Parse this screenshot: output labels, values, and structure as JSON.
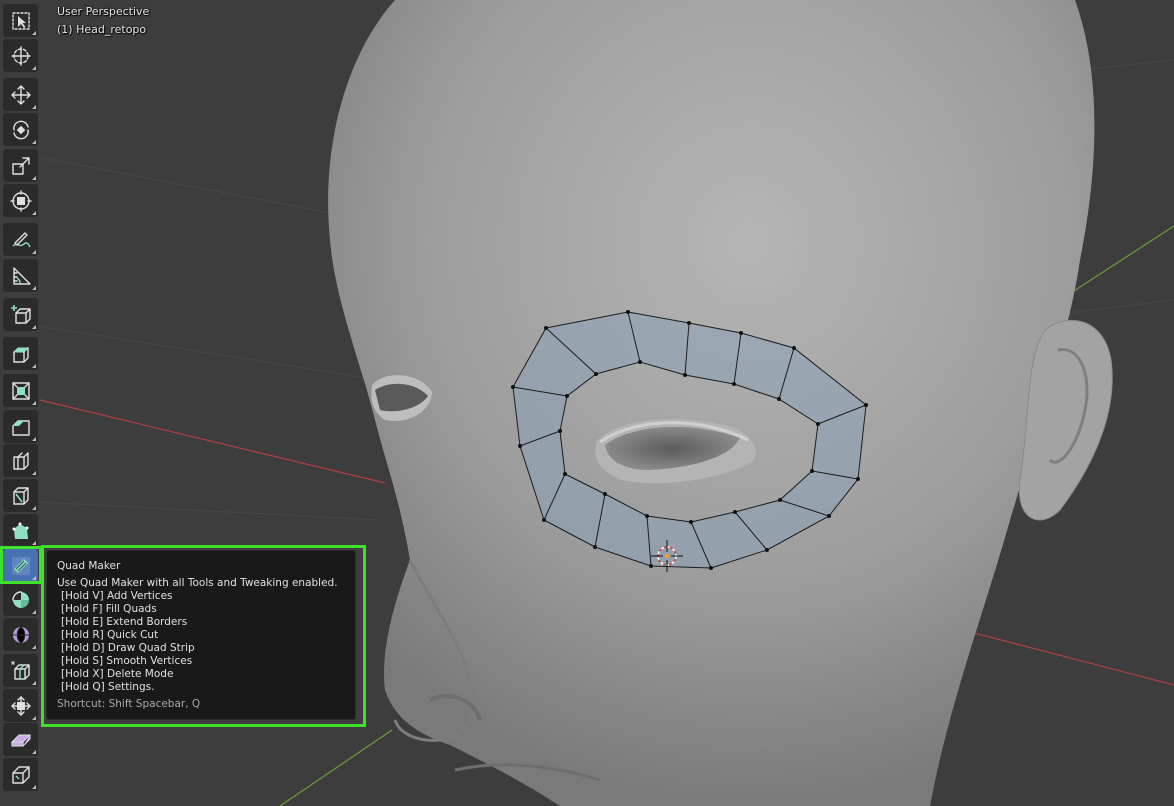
{
  "viewport": {
    "view_name": "User Perspective",
    "object_label": "(1) Head_retopo"
  },
  "toolbar": {
    "tools": [
      {
        "icon": "select-box-icon"
      },
      {
        "icon": "cursor-icon"
      },
      {
        "icon": "move-icon"
      },
      {
        "icon": "rotate-icon"
      },
      {
        "icon": "scale-icon"
      },
      {
        "icon": "transform-icon"
      },
      {
        "icon": "annotate-icon"
      },
      {
        "icon": "measure-icon"
      },
      {
        "icon": "add-cube-icon"
      },
      {
        "icon": "extrude-region-icon"
      },
      {
        "icon": "inset-faces-icon"
      },
      {
        "icon": "bevel-icon"
      },
      {
        "icon": "loop-cut-icon"
      },
      {
        "icon": "knife-icon"
      },
      {
        "icon": "poly-build-icon"
      },
      {
        "icon": "quad-maker-icon",
        "active": true
      },
      {
        "icon": "spin-icon"
      },
      {
        "icon": "smooth-icon"
      },
      {
        "icon": "edge-slide-icon"
      },
      {
        "icon": "shrink-fatten-icon"
      },
      {
        "icon": "shear-icon"
      },
      {
        "icon": "rip-region-icon"
      }
    ]
  },
  "tooltip": {
    "title": "Quad Maker",
    "description": "Use Quad Maker with all Tools and Tweaking enabled.",
    "keys": [
      "[Hold V] Add Vertices",
      "[Hold F] Fill Quads",
      "[Hold E] Extend Borders",
      "[Hold R] Quick Cut",
      "[Hold D] Draw Quad Strip",
      "[Hold S] Smooth Vertices",
      "[Hold X] Delete Mode",
      "[Hold Q] Settings."
    ],
    "shortcut": "Shortcut: Shift Spacebar, Q"
  },
  "colors": {
    "viewport_bg": "#3d3d3d",
    "tool_bg": "#2b2b2b",
    "tool_active": "#4772b3",
    "highlight": "#3fe12a",
    "x_axis": "#b04040",
    "y_axis": "#6a9a3a",
    "tooltip_bg": "#191919"
  }
}
